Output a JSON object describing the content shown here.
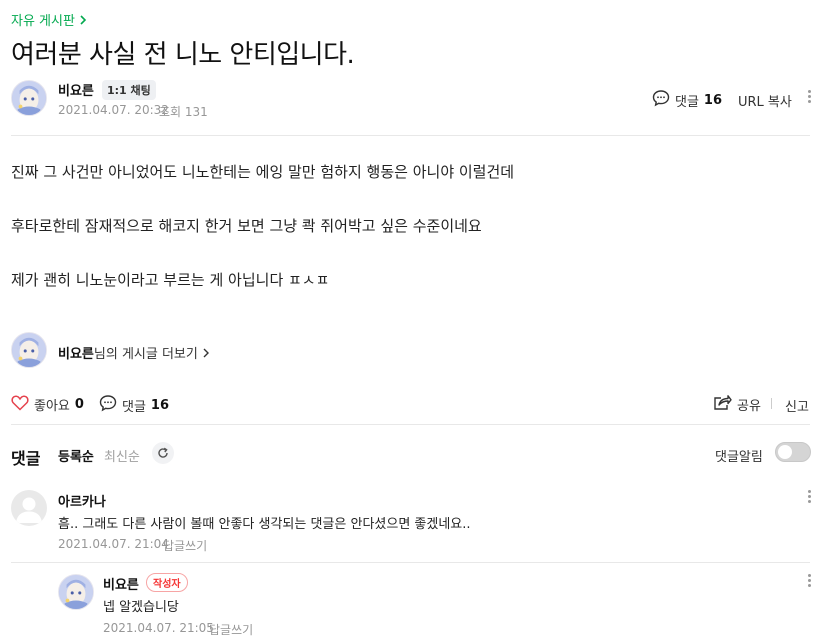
{
  "board": {
    "label": "자유 게시판",
    "chevron": "chevron-right-icon"
  },
  "post": {
    "title": "여러분 사실 전 니노 안티입니다.",
    "author": "비요른",
    "chat_label": "1:1 채팅",
    "date": "2021.04.07. 20:32",
    "views_label": "조회 131",
    "comment_count_label": "댓글",
    "comment_count": "16",
    "url_copy_label": "URL 복사",
    "body": [
      "진짜 그 사건만 아니었어도 니노한테는 에잉 말만 험하지 행동은 아니야 이럴건데",
      "후타로한테 잠재적으로 해코지 한거 보면 그냥 콱 쥐어박고 싶은 수준이네요",
      "제가 괜히 니노눈이라고 부르는 게 아닙니다 ㅍㅅㅍ"
    ],
    "more_posts_author": "비요른",
    "more_posts_suffix": "님의 게시글 더보기"
  },
  "actions": {
    "like_label": "좋아요",
    "like_count": "0",
    "comment_label": "댓글",
    "comment_count": "16",
    "share_label": "공유",
    "report_label": "신고"
  },
  "comments_section": {
    "title": "댓글",
    "sort_registered": "등록순",
    "sort_latest": "최신순",
    "notify_label": "댓글알림",
    "notify_on": false
  },
  "comments": [
    {
      "author": "아르카나",
      "text": "흠.. 그래도 다른 사람이 볼때 안좋다 생각되는 댓글은 안다셨으면 좋겠네요..",
      "date": "2021.04.07. 21:04",
      "reply_label": "답글쓰기"
    },
    {
      "author": "비요른",
      "badge": "작성자",
      "text": "넵 알겠습니당",
      "date": "2021.04.07. 21:05",
      "reply_label": "답글쓰기"
    }
  ],
  "colors": {
    "board_green": "#03a94f",
    "heart_red": "#e5424d",
    "writer_red": "#f53535"
  }
}
